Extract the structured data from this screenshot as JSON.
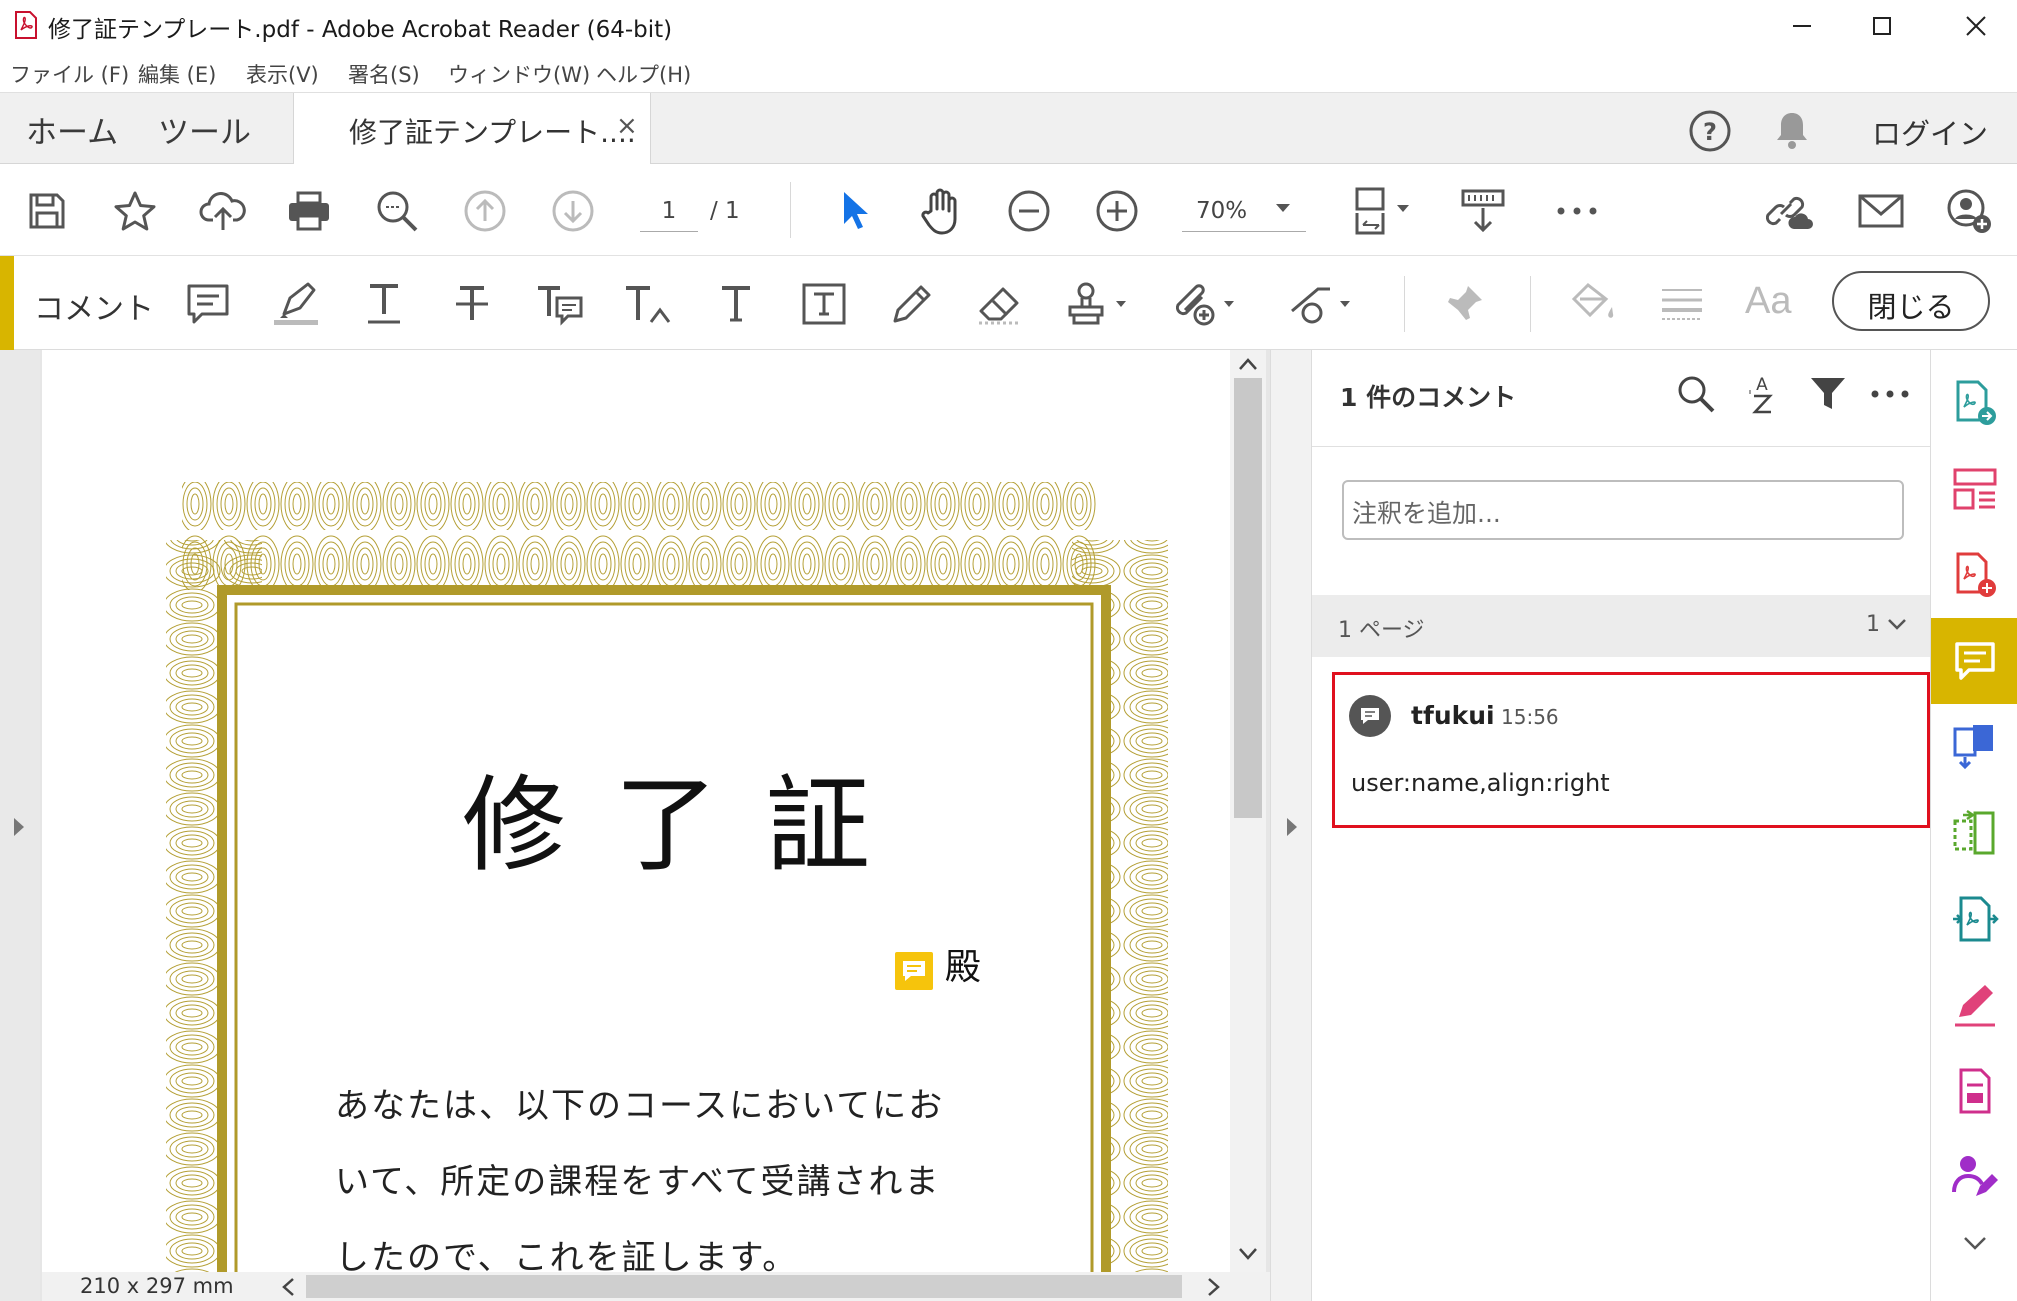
{
  "window": {
    "title": "修了証テンプレート.pdf - Adobe Acrobat Reader (64-bit)"
  },
  "menu": [
    "ファイル (F)",
    "編集 (E)",
    "表示(V)",
    "署名(S)",
    "ウィンドウ(W)",
    "ヘルプ(H)"
  ],
  "tabs": {
    "home": "ホーム",
    "tools": "ツール",
    "document": "修了証テンプレート....",
    "close": "×",
    "login": "ログイン"
  },
  "toolbar": {
    "page_current": "1",
    "page_total": "/ 1",
    "zoom": "70%"
  },
  "comment_toolbar": {
    "label": "コメント",
    "font_button": "Aa",
    "close_button": "閉じる"
  },
  "document": {
    "title": "修了証",
    "honorific": "殿",
    "body_lines": [
      "あなたは、以下のコースにおいてにお",
      "いて、所定の課程をすべて受講されま",
      "したので、これを証します。"
    ],
    "page_size": "210 x 297 mm"
  },
  "comments_panel": {
    "count_label": "1 件のコメント",
    "add_note_placeholder": "注釈を追加...",
    "page_group_label": "1 ページ",
    "page_group_count": "1",
    "comments": [
      {
        "author": "tfukui",
        "time": "15:56",
        "text": "user:name,align:right"
      }
    ]
  },
  "colors": {
    "accent": "#d8b500",
    "selection_border": "#e0101e",
    "certificate_gold": "#b09a2a",
    "select_tool_blue": "#1473e6"
  }
}
